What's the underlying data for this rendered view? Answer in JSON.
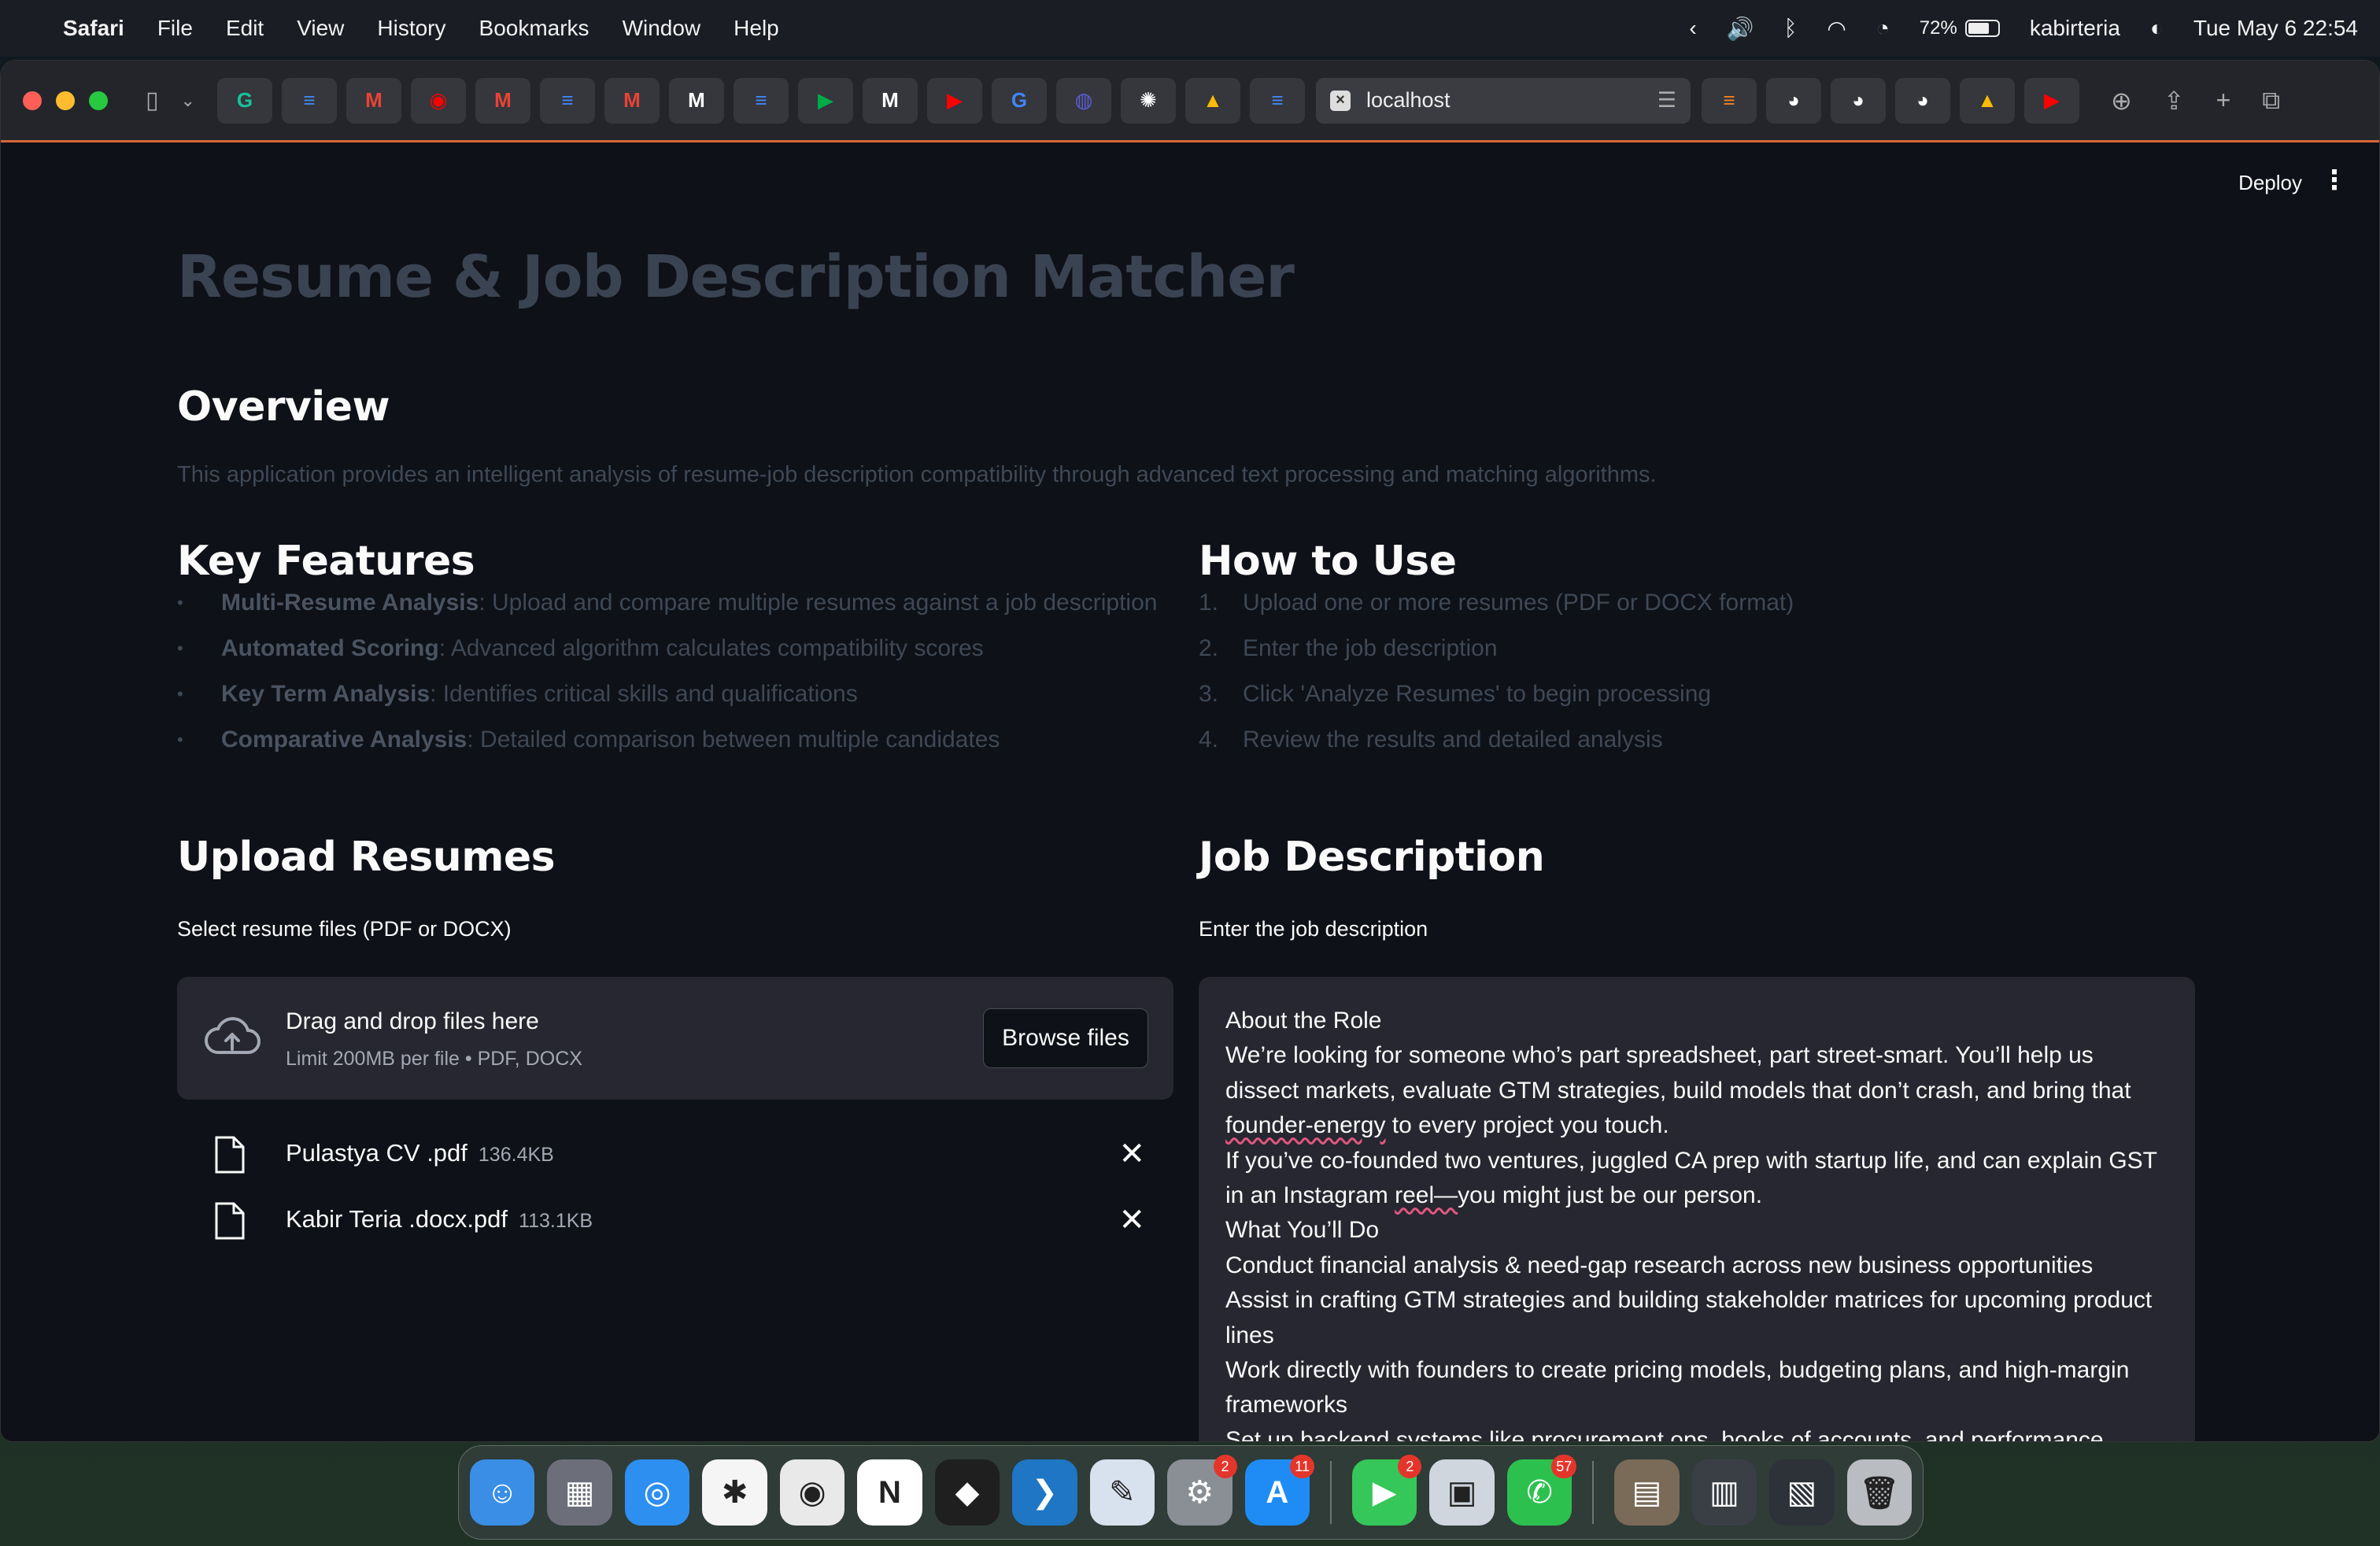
{
  "menubar": {
    "app_name": "Safari",
    "items": [
      "File",
      "Edit",
      "View",
      "History",
      "Bookmarks",
      "Window",
      "Help"
    ],
    "battery": "72%",
    "battery_level": 0.72,
    "user": "kabirteria",
    "datetime": "Tue May 6  22:54"
  },
  "browser": {
    "url": "localhost",
    "tab_icons": [
      "grammarly-icon",
      "docs-icon",
      "gmail-icon",
      "youtube-music-icon",
      "gmail-icon",
      "docs-icon",
      "gmail-icon",
      "medium-icon",
      "docs-icon",
      "meet-icon",
      "medium-icon",
      "youtube-icon",
      "google-icon",
      "app-icon",
      "openai-icon",
      "drive-icon",
      "docs-icon"
    ],
    "right_tab_icons": [
      "stackoverflow-icon",
      "github-icon",
      "github-icon",
      "github-icon",
      "drive-icon",
      "youtube-icon"
    ]
  },
  "header": {
    "deploy_label": "Deploy"
  },
  "page": {
    "title": "Resume & Job Description Matcher",
    "overview": {
      "heading": "Overview",
      "text": "This application provides an intelligent analysis of resume-job description compatibility through advanced text processing and matching algorithms."
    },
    "features": {
      "heading": "Key Features",
      "items": [
        {
          "name": "Multi-Resume Analysis",
          "desc": ": Upload and compare multiple resumes against a job description"
        },
        {
          "name": "Automated Scoring",
          "desc": ": Advanced algorithm calculates compatibility scores"
        },
        {
          "name": "Key Term Analysis",
          "desc": ": Identifies critical skills and qualifications"
        },
        {
          "name": "Comparative Analysis",
          "desc": ": Detailed comparison between multiple candidates"
        }
      ]
    },
    "howto": {
      "heading": "How to Use",
      "steps": [
        {
          "num": "1.",
          "text": "Upload one or more resumes (PDF or DOCX format)"
        },
        {
          "num": "2.",
          "text": "Enter the job description"
        },
        {
          "num": "3.",
          "text": "Click 'Analyze Resumes' to begin processing"
        },
        {
          "num": "4.",
          "text": "Review the results and detailed analysis"
        }
      ]
    },
    "upload": {
      "heading": "Upload Resumes",
      "label": "Select resume files (PDF or DOCX)",
      "drop_title": "Drag and drop files here",
      "drop_sub": "Limit 200MB per file • PDF, DOCX",
      "browse_label": "Browse files",
      "files": [
        {
          "name": "Pulastya CV .pdf",
          "size": "136.4KB"
        },
        {
          "name": "Kabir Teria .docx.pdf",
          "size": "113.1KB"
        }
      ]
    },
    "job": {
      "heading": "Job Description",
      "label": "Enter the job description",
      "lines": [
        "About the Role",
        "We’re looking for someone who’s part spreadsheet, part street-smart. You’ll help us",
        "dissect markets, evaluate GTM strategies, build models that don’t crash, and bring that",
        "founder-energy to every project you touch.",
        "If you’ve co-founded two ventures, juggled CA prep with startup life, and can explain GST",
        "in an Instagram reel—you might just be our person.",
        "What You’ll Do",
        "Conduct financial analysis & need-gap research across new business opportunities",
        "Assist in crafting GTM strategies and building stakeholder matrices for upcoming product",
        "lines",
        "Work directly with founders to create pricing models, budgeting plans, and high-margin",
        "frameworks",
        "Set up backend systems like procurement ops, books of accounts, and performance"
      ]
    }
  },
  "dock": {
    "apps": [
      {
        "name": "finder-icon",
        "color": "#3a8ee6",
        "glyph": "☺",
        "badge": ""
      },
      {
        "name": "launchpad-icon",
        "color": "#6c6f7a",
        "glyph": "▦",
        "badge": ""
      },
      {
        "name": "safari-icon",
        "color": "#2d8ff0",
        "glyph": "◎",
        "badge": ""
      },
      {
        "name": "perplexity-icon",
        "color": "#f5f5f5",
        "glyph": "✱",
        "badge": ""
      },
      {
        "name": "chrome-icon",
        "color": "#e9e9e9",
        "glyph": "◉",
        "badge": ""
      },
      {
        "name": "notion-icon",
        "color": "#ffffff",
        "glyph": "N",
        "badge": ""
      },
      {
        "name": "cube-app-icon",
        "color": "#1f1f1f",
        "glyph": "◆",
        "badge": ""
      },
      {
        "name": "vscode-icon",
        "color": "#1e76c4",
        "glyph": "❯",
        "badge": ""
      },
      {
        "name": "pages-icon",
        "color": "#d8e2ef",
        "glyph": "✎",
        "badge": ""
      },
      {
        "name": "system-settings-icon",
        "color": "#8a8f96",
        "glyph": "⚙",
        "badge": "2"
      },
      {
        "name": "app-store-icon",
        "color": "#1f8cf5",
        "glyph": "A",
        "badge": "11"
      },
      {
        "name": "facetime-icon",
        "color": "#35c759",
        "glyph": "▶",
        "badge": "2"
      },
      {
        "name": "preview-icon",
        "color": "#cfd6de",
        "glyph": "▣",
        "badge": ""
      },
      {
        "name": "whatsapp-icon",
        "color": "#2cc14f",
        "glyph": "✆",
        "badge": "57"
      },
      {
        "name": "photo-stack-icon",
        "color": "#7a6a58",
        "glyph": "▤",
        "badge": ""
      },
      {
        "name": "window-stack-icon",
        "color": "#3a3f46",
        "glyph": "▥",
        "badge": ""
      },
      {
        "name": "window-stack-2-icon",
        "color": "#2d3238",
        "glyph": "▧",
        "badge": ""
      },
      {
        "name": "trash-icon",
        "color": "#b9bcc0",
        "glyph": "🗑",
        "badge": ""
      }
    ]
  }
}
